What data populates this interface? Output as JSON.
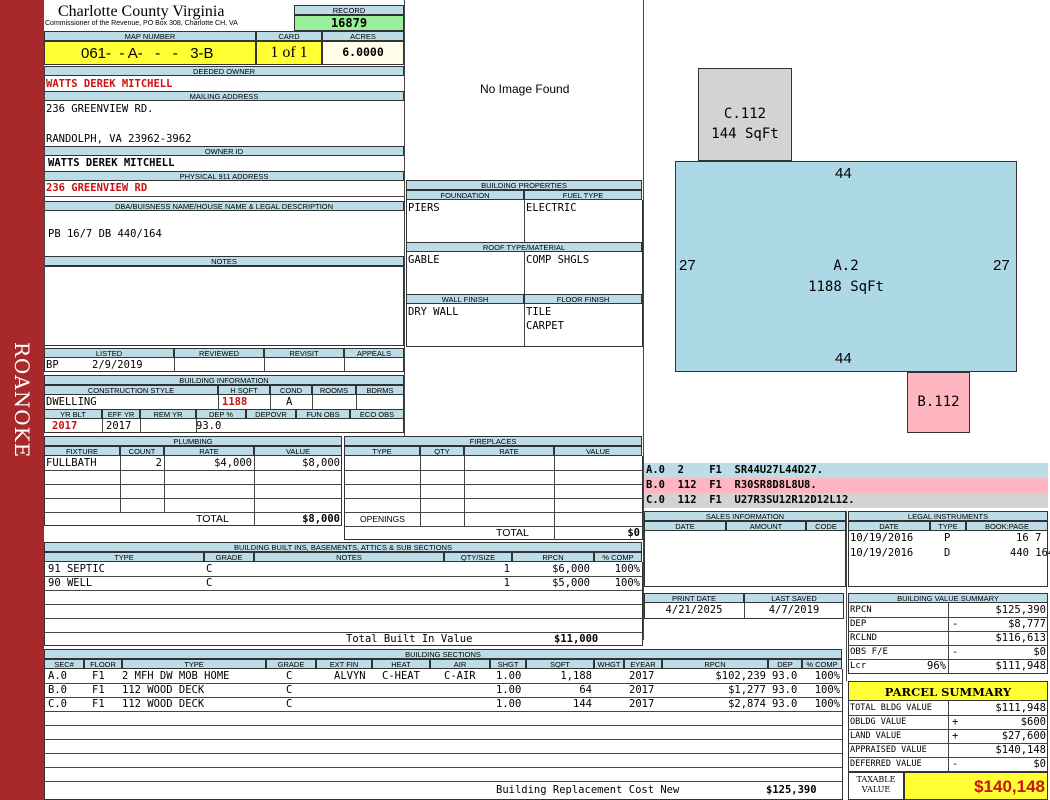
{
  "sidebar": {
    "label": "ROANOKE"
  },
  "header": {
    "county": "Charlotte County Virginia",
    "address_line": "Commissioner of the Revenue, PO Box 308, Charlotte CH, VA",
    "record_label": "RECORD",
    "record_value": "16879",
    "map_number_label": "MAP NUMBER",
    "map_number": "061-  - A-   -   -   3-B",
    "card_label": "CARD",
    "card_value": "1 of 1",
    "acres_label": "ACRES",
    "acres_value": "6.0000"
  },
  "owner": {
    "deeded_owner_label": "DEEDED OWNER",
    "deeded_owner": "WATTS DEREK MITCHELL",
    "mailing_address_label": "MAILING ADDRESS",
    "mailing_line1": "236 GREENVIEW RD.",
    "mailing_line2": "RANDOLPH, VA 23962-3962",
    "owner_id_label": "OWNER ID",
    "owner_id": "WATTS DEREK MITCHELL",
    "physical_label": "PHYSICAL 911 ADDRESS",
    "physical_address": "236 GREENVIEW RD",
    "dba_label": "DBA/BUISNESS NAME/HOUSE NAME & LEGAL DESCRIPTION",
    "dba_value": "PB 16/7 DB 440/164",
    "notes_label": "NOTES"
  },
  "image": {
    "no_image": "No Image Found"
  },
  "building_properties": {
    "title": "BUILDING PROPERTIES",
    "foundation_label": "FOUNDATION",
    "foundation": "PIERS",
    "fuel_label": "FUEL TYPE",
    "fuel": "ELECTRIC",
    "roof_label": "ROOF TYPE/MATERIAL",
    "roof_type": "GABLE",
    "roof_material": "COMP SHGLS",
    "wall_label": "WALL FINISH",
    "wall": "DRY WALL",
    "floor_label": "FLOOR FINISH",
    "floor1": "TILE",
    "floor2": "CARPET"
  },
  "sketch": {
    "c_label": "C.112",
    "c_area": "144 SqFt",
    "a_label": "A.2",
    "a_area": "1188 SqFt",
    "b_label": "B.112",
    "dim_top": "44",
    "dim_bottom": "44",
    "dim_left": "27",
    "dim_right": "27"
  },
  "sketch_codes": [
    "A.0  2    F1  SR44U27L44D27.",
    "B.0  112  F1  R30SR8D8L8U8.",
    "C.0  112  F1  U27R3SU12R12D12L12."
  ],
  "listed": {
    "listed_label": "LISTED",
    "reviewed_label": "REVIEWED",
    "revisit_label": "REVISIT",
    "appeals_label": "APPEALS",
    "listed_by": "BP",
    "listed_date": "2/9/2019"
  },
  "building_info": {
    "title": "BUILDING INFORMATION",
    "style_label": "CONSTRUCTION STYLE",
    "hsqft_label": "H SQFT",
    "cond_label": "COND",
    "rooms_label": "ROOMS",
    "bdrms_label": "BDRMS",
    "style": "DWELLING",
    "hsqft": "1188",
    "cond": "A",
    "yrblt_label": "YR BLT",
    "effyr_label": "EFF YR",
    "remyr_label": "REM YR",
    "dep_label": "DEP %",
    "depovr_label": "DEPOVR",
    "funobs_label": "FUN OBS",
    "ecoobs_label": "ECO OBS",
    "yrblt": "2017",
    "effyr": "2017",
    "dep": "93.0"
  },
  "plumbing": {
    "title": "PLUMBING",
    "fixture_label": "FIXTURE",
    "count_label": "COUNT",
    "rate_label": "RATE",
    "value_label": "VALUE",
    "fixture": "FULLBATH",
    "count": "2",
    "rate": "$4,000",
    "value": "$8,000",
    "total_label": "TOTAL",
    "total": "$8,000"
  },
  "fireplaces": {
    "title": "FIREPLACES",
    "type_label": "TYPE",
    "qty_label": "QTY",
    "rate_label": "RATE",
    "value_label": "VALUE",
    "openings_label": "OPENINGS",
    "total_label": "TOTAL",
    "total": "$0"
  },
  "sales": {
    "title": "SALES INFORMATION",
    "date_label": "DATE",
    "amount_label": "AMOUNT",
    "code_label": "CODE"
  },
  "legal": {
    "title": "LEGAL INSTRUMENTS",
    "date_label": "DATE",
    "type_label": "TYPE",
    "book_label": "BOOK:PAGE",
    "rows": [
      {
        "date": "10/19/2016",
        "type": "P",
        "book": "16 7"
      },
      {
        "date": "10/19/2016",
        "type": "D",
        "book": "440 164"
      }
    ]
  },
  "built_ins": {
    "title": "BUILDING BUILT INS, BASEMENTS, ATTICS & SUB SECTIONS",
    "type_label": "TYPE",
    "grade_label": "GRADE",
    "notes_label": "NOTES",
    "qty_label": "QTY/SIZE",
    "rpcn_label": "RPCN",
    "comp_label": "% COMP",
    "rows": [
      {
        "type": "91 SEPTIC",
        "grade": "C",
        "qty": "1",
        "rpcn": "$6,000",
        "comp": "100%"
      },
      {
        "type": "90 WELL",
        "grade": "C",
        "qty": "1",
        "rpcn": "$5,000",
        "comp": "100%"
      }
    ],
    "total_label": "Total Built In Value",
    "total": "$11,000"
  },
  "dates": {
    "print_label": "PRINT DATE",
    "print_date": "4/21/2025",
    "saved_label": "LAST SAVED",
    "saved_date": "4/7/2019"
  },
  "value_summary": {
    "title": "BUILDING VALUE SUMMARY",
    "rows": [
      {
        "label": "RPCN",
        "sign": "",
        "value": "$125,390"
      },
      {
        "label": "DEP",
        "sign": "-",
        "value": "$8,777"
      },
      {
        "label": "RCLND",
        "sign": "",
        "value": "$116,613"
      },
      {
        "label": "OBS F/E",
        "sign": "-",
        "value": "$0"
      },
      {
        "label": "Lcr",
        "sign": "96%",
        "value": "$111,948"
      }
    ]
  },
  "sections": {
    "title": "BUILDING SECTIONS",
    "headers": [
      "SEC#",
      "FLOOR",
      "TYPE",
      "GRADE",
      "EXT FIN",
      "HEAT",
      "AIR",
      "SHGT",
      "SQFT",
      "WHGT",
      "EYEAR",
      "RPCN",
      "DEP",
      "% COMP"
    ],
    "rows": [
      {
        "sec": "A.0",
        "floor": "F1",
        "type": "2 MFH DW MOB HOME",
        "grade": "C",
        "ext": "ALVYN",
        "heat": "C-HEAT",
        "air": "C-AIR",
        "shgt": "1.00",
        "sqft": "1,188",
        "eyear": "2017",
        "rpcn": "$102,239",
        "dep": "93.0",
        "comp": "100%"
      },
      {
        "sec": "B.0",
        "floor": "F1",
        "type": "112 WOOD DECK",
        "grade": "C",
        "ext": "",
        "heat": "",
        "air": "",
        "shgt": "1.00",
        "sqft": "64",
        "eyear": "2017",
        "rpcn": "$1,277",
        "dep": "93.0",
        "comp": "100%"
      },
      {
        "sec": "C.0",
        "floor": "F1",
        "type": "112 WOOD DECK",
        "grade": "C",
        "ext": "",
        "heat": "",
        "air": "",
        "shgt": "1.00",
        "sqft": "144",
        "eyear": "2017",
        "rpcn": "$2,874",
        "dep": "93.0",
        "comp": "100%"
      }
    ],
    "brcn_label": "Building Replacement Cost New",
    "brcn": "$125,390"
  },
  "parcel": {
    "title": "PARCEL SUMMARY",
    "rows": [
      {
        "label": "TOTAL BLDG VALUE",
        "sign": "",
        "value": "$111,948"
      },
      {
        "label": "OBLDG VALUE",
        "sign": "+",
        "value": "$600"
      },
      {
        "label": "LAND VALUE",
        "sign": "+",
        "value": "$27,600"
      },
      {
        "label": "APPRAISED VALUE",
        "sign": "",
        "value": "$140,148"
      },
      {
        "label": "DEFERRED VALUE",
        "sign": "-",
        "value": "$0"
      }
    ],
    "taxable_label1": "TAXABLE",
    "taxable_label2": "VALUE",
    "taxable": "$140,148"
  },
  "colors": {
    "sidebar": "#a8282c",
    "header_fill": "#bcdde8",
    "record_green": "#99ee99",
    "yellow": "#ffff33",
    "accent_red": "#cc1111",
    "sketch_blue": "#add8e6",
    "sketch_gray": "#d3d3d3",
    "sketch_pink": "#ffb6c1"
  }
}
